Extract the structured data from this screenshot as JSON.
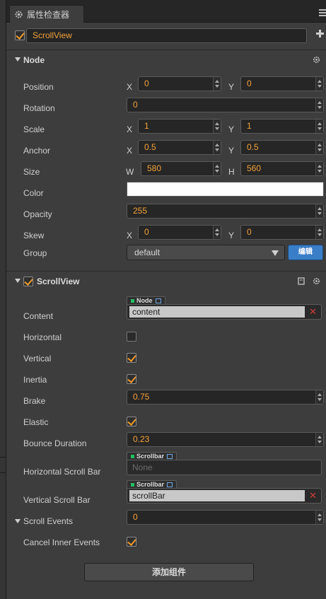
{
  "tab": {
    "title": "属性检查器"
  },
  "entity": {
    "name": "ScrollView",
    "enabled": true
  },
  "node": {
    "title": "Node",
    "position": {
      "label": "Position",
      "x": "0",
      "y": "0"
    },
    "rotation": {
      "label": "Rotation",
      "value": "0"
    },
    "scale": {
      "label": "Scale",
      "x": "1",
      "y": "1"
    },
    "anchor": {
      "label": "Anchor",
      "x": "0.5",
      "y": "0.5"
    },
    "size": {
      "label": "Size",
      "w": "580",
      "h": "560"
    },
    "color": {
      "label": "Color",
      "value": "#ffffff"
    },
    "opacity": {
      "label": "Opacity",
      "value": "255"
    },
    "skew": {
      "label": "Skew",
      "x": "0",
      "y": "0"
    },
    "group": {
      "label": "Group",
      "value": "default",
      "edit_label": "编辑"
    },
    "axes": {
      "x": "X",
      "y": "Y",
      "w": "W",
      "h": "H"
    }
  },
  "scrollview": {
    "title": "ScrollView",
    "enabled": true,
    "content": {
      "label": "Content",
      "type": "Node",
      "value": "content"
    },
    "horizontal": {
      "label": "Horizontal",
      "checked": false
    },
    "vertical": {
      "label": "Vertical",
      "checked": true
    },
    "inertia": {
      "label": "Inertia",
      "checked": true
    },
    "brake": {
      "label": "Brake",
      "value": "0.75"
    },
    "elastic": {
      "label": "Elastic",
      "checked": true
    },
    "bounce_duration": {
      "label": "Bounce Duration",
      "value": "0.23"
    },
    "h_scrollbar": {
      "label": "Horizontal Scroll Bar",
      "type": "Scrollbar",
      "value": "None"
    },
    "v_scrollbar": {
      "label": "Vertical Scroll Bar",
      "type": "Scrollbar",
      "value": "scrollBar"
    },
    "scroll_events": {
      "label": "Scroll Events",
      "value": "0"
    },
    "cancel_inner": {
      "label": "Cancel Inner Events",
      "checked": true
    }
  },
  "add_component_label": "添加组件",
  "colors": {
    "accent": "#f19a2a",
    "value_text": "#f3a23a",
    "edit_button": "#3a7ec8",
    "remove": "#d23b3b"
  }
}
